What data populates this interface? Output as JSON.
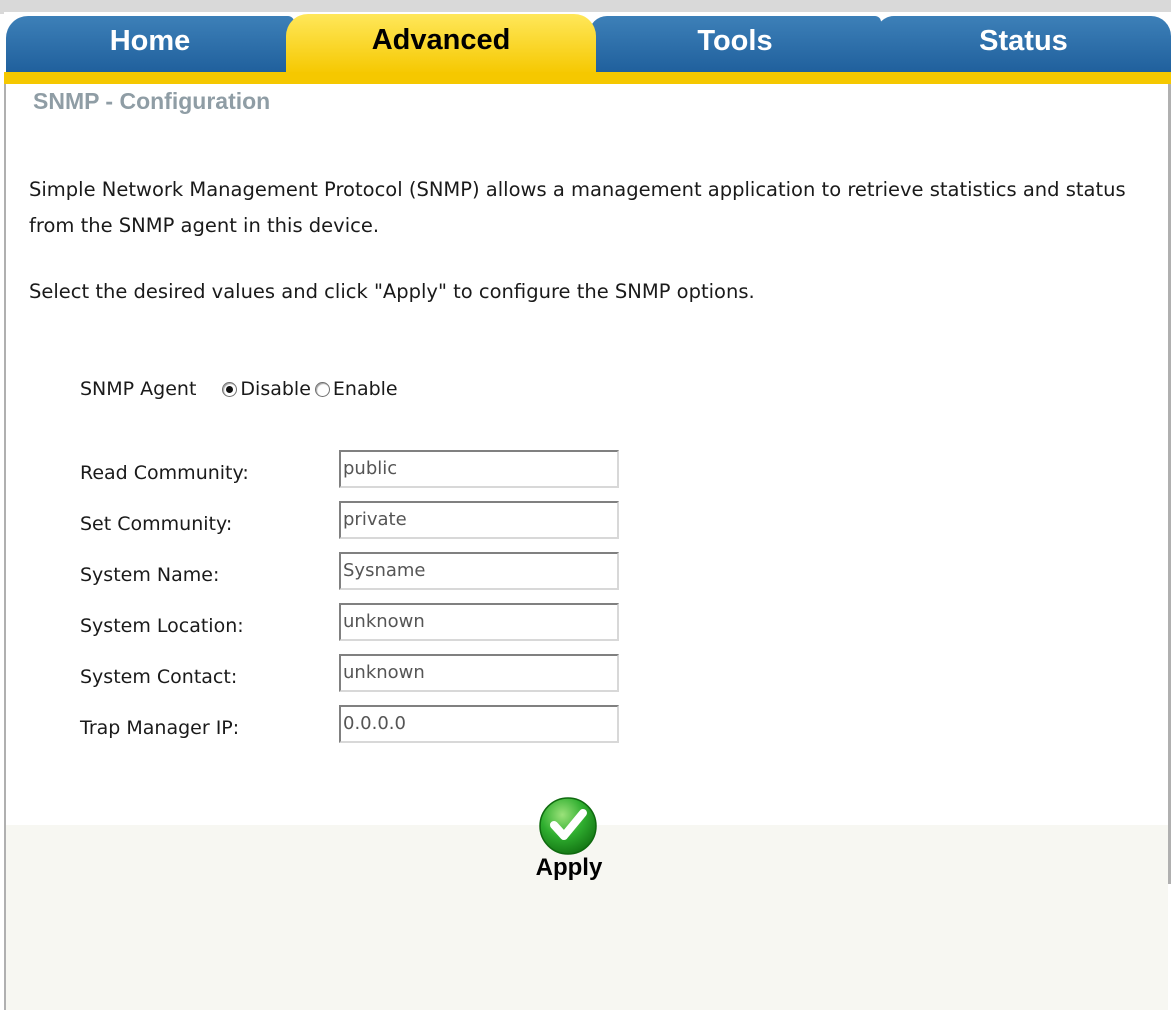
{
  "tabs": {
    "home": "Home",
    "advanced": "Advanced",
    "tools": "Tools",
    "status": "Status",
    "active": "Advanced"
  },
  "page": {
    "title": "SNMP - Configuration",
    "description": "Simple Network Management Protocol (SNMP) allows a management application to retrieve statistics and status from the SNMP agent in this device.",
    "instruction": "Select the desired values and click \"Apply\" to configure the SNMP options."
  },
  "snmp_agent": {
    "label": "SNMP Agent",
    "options": [
      "Disable",
      "Enable"
    ],
    "selected": "Disable"
  },
  "fields": [
    {
      "label": "Read Community:",
      "value": "public"
    },
    {
      "label": "Set Community:",
      "value": "private"
    },
    {
      "label": "System Name:",
      "value": "Sysname"
    },
    {
      "label": "System Location:",
      "value": "unknown"
    },
    {
      "label": "System Contact:",
      "value": "unknown"
    },
    {
      "label": "Trap Manager IP:",
      "value": "0.0.0.0"
    }
  ],
  "apply": {
    "label": "Apply",
    "icon": "checkmark-icon"
  },
  "colors": {
    "tab_blue": "#2a6aa8",
    "tab_active_yellow": "#f5c800",
    "title_grey": "#8f9da5",
    "apply_green": "#2fae2f"
  }
}
